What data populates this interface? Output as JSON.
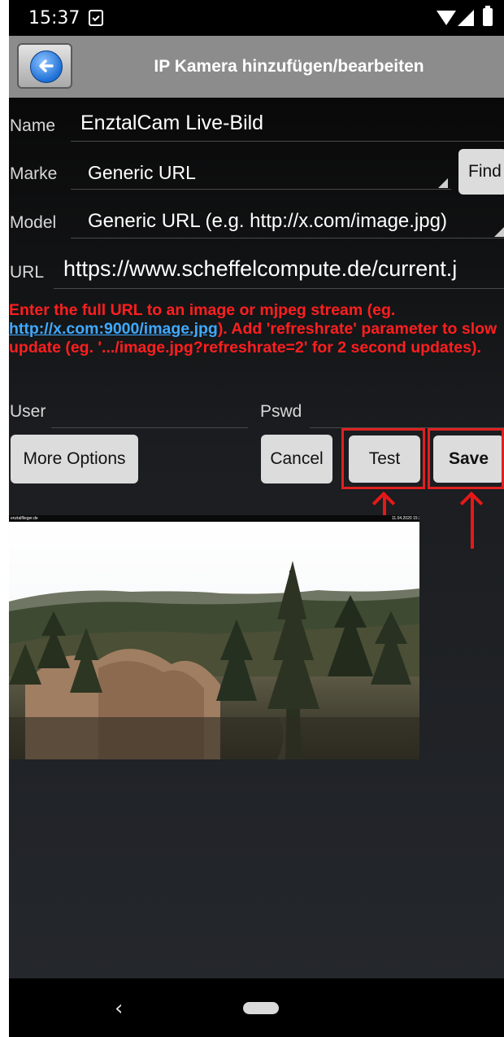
{
  "status": {
    "time": "15:37"
  },
  "header": {
    "title": "IP Kamera hinzufügen/bearbeiten"
  },
  "form": {
    "name_label": "Name",
    "name_value": "EnztalCam Live-Bild",
    "brand_label": "Marke",
    "brand_value": "Generic URL",
    "find_label": "Find",
    "model_label": "Model",
    "model_value": "Generic URL (e.g. http://x.com/image.jpg)",
    "url_label": "URL",
    "url_value": "https://www.scheffelcompute.de/current.j",
    "help_pre": "Enter the full URL to an image or mjpeg stream (eg. ",
    "help_link": "http://x.com:9000/image.jpg",
    "help_post": "). Add 'refreshrate' parameter to slow update (eg. '.../image.jpg?refreshrate=2' for 2 second updates).",
    "user_label": "User",
    "user_value": "",
    "pswd_label": "Pswd",
    "pswd_value": ""
  },
  "buttons": {
    "more_options": "More Options",
    "cancel": "Cancel",
    "test": "Test",
    "save": "Save"
  },
  "preview": {
    "caption_left": "enztalflieger.de",
    "caption_right": "11.04.2020 15:32 Uhr"
  },
  "colors": {
    "annotation": "#e02020",
    "help_text": "#ff1f1f",
    "link": "#3fa9ff",
    "titlebar": "#8c8c8c"
  }
}
